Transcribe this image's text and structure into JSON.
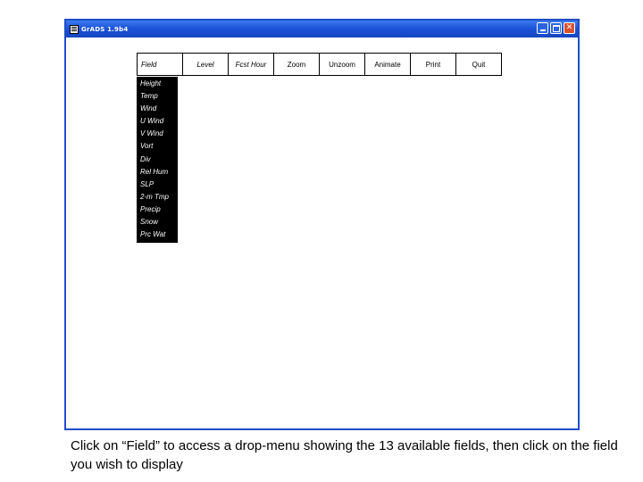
{
  "window": {
    "title": "GrADS 1.9b4",
    "icon": "grads-app-icon",
    "controls": [
      "minimize-icon",
      "maximize-icon",
      "close-icon"
    ]
  },
  "menubar": {
    "items": [
      {
        "label": "Field",
        "name": "menu-field",
        "active": true
      },
      {
        "label": "Level",
        "name": "menu-level"
      },
      {
        "label": "Fcst Hour",
        "name": "menu-fcst-hour"
      },
      {
        "label": "Zoom",
        "name": "menu-zoom"
      },
      {
        "label": "Unzoom",
        "name": "menu-unzoom"
      },
      {
        "label": "Animate",
        "name": "menu-animate"
      },
      {
        "label": "Print",
        "name": "menu-print"
      },
      {
        "label": "Quit",
        "name": "menu-quit"
      }
    ]
  },
  "field_menu": {
    "items": [
      "Height",
      "Temp",
      "Wind",
      "U Wind",
      "V Wind",
      "Vort",
      "Div",
      "Rel Hum",
      "SLP",
      "2-m Tmp",
      "Precip",
      "Snow",
      "Prc Wat"
    ]
  },
  "caption": "Click on “Field” to access a drop-menu showing the 13 available fields, then click on the field you wish to display",
  "colors": {
    "titlebar": "#1c54d8",
    "menu_bg": "#000000",
    "menu_text": "#ffffff",
    "close_button": "#d9512c"
  }
}
